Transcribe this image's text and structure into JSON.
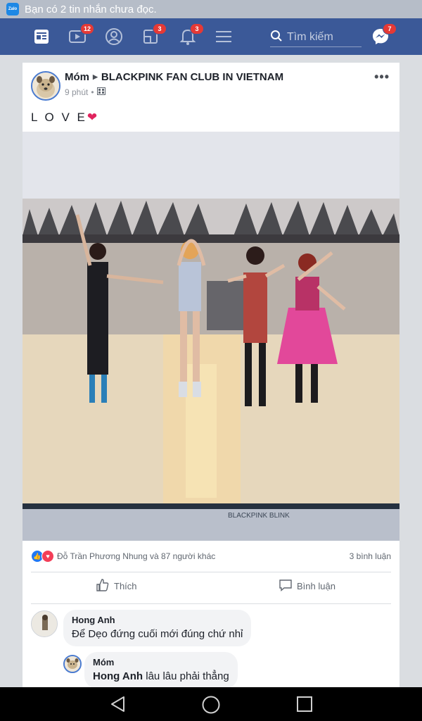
{
  "statusbar": {
    "app_icon": "zalo-icon",
    "app_icon_text": "Zalo",
    "notification": "Bạn có 2 tin nhắn chưa đọc."
  },
  "fb_nav": {
    "items": [
      {
        "icon": "news-feed-icon",
        "badge": ""
      },
      {
        "icon": "video-icon",
        "badge": "12"
      },
      {
        "icon": "profile-icon",
        "badge": ""
      },
      {
        "icon": "pages-icon",
        "badge": "3"
      },
      {
        "icon": "notifications-bell-icon",
        "badge": "3"
      },
      {
        "icon": "menu-icon",
        "badge": ""
      }
    ],
    "search": {
      "placeholder": "Tìm kiếm"
    },
    "messenger": {
      "icon": "messenger-icon",
      "badge": "7"
    }
  },
  "post": {
    "author": "Móm",
    "group": "BLACKPINK FAN CLUB IN VIETNAM",
    "time": "9 phút",
    "privacy_icon": "group-privacy-icon",
    "text": "L O V E",
    "text_emoji": "❤",
    "photo_watermark": "BLACKPINK   BLINK",
    "reactions": {
      "icons": [
        "like-reaction-icon",
        "love-reaction-icon"
      ],
      "names": "Đỗ Trần Phương Nhung và 87 người khác",
      "comment_count": "3 bình luận"
    },
    "actions": {
      "like_label": "Thích",
      "comment_label": "Bình luận"
    }
  },
  "comments": [
    {
      "author": "Hong Anh",
      "text": "Để Dẹo đứng cuối mới đúng chứ nhỉ"
    },
    {
      "author": "Móm",
      "mention": "Hong Anh",
      "text": " lâu lâu phải thẳng"
    }
  ],
  "colors": {
    "facebook_blue": "#3b5998",
    "badge_red": "#e53935",
    "status_bar": "#b6bdc8",
    "feed_background": "#dadde1"
  }
}
